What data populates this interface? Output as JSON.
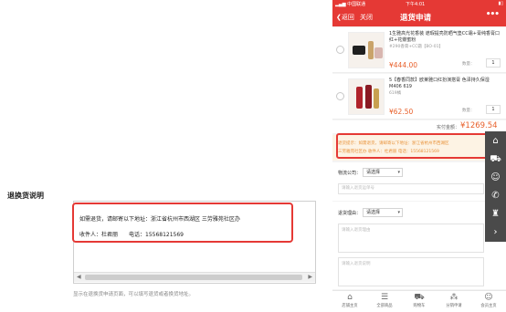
{
  "admin": {
    "section_title": "退换货说明",
    "textbox_line1": "如需退货，请邮寄以下地址：浙江省杭州市西湖区 三劳雅苑社区办",
    "textbox_line2": "收件人：杜君丽　　电话：15568121569",
    "hint": "显示在退换货申请页面，可以填写退货或者换货地址。"
  },
  "phone": {
    "status_bar": {
      "carrier": "中国联通",
      "time": "下午4:01"
    },
    "nav": {
      "back": "返回",
      "close": "关闭",
      "title": "退货申请",
      "more": "•••"
    },
    "products": [
      {
        "name": "1生雅高光花香装 遮瑕提亮防晒气垫CC霜+膏纯香膏口红+花瓣蜜粉",
        "spec": "#290香膏+CC霜【BO-01】",
        "price": "¥444.00",
        "qty_label": "数量：",
        "qty": "1"
      },
      {
        "name": "5【春香同款】欧莱雅口红扮演搭膏 色泽持久保湿 M406 619",
        "spec": "619橘",
        "price": "¥62.50",
        "qty_label": "数量：",
        "qty": "1"
      }
    ],
    "total": {
      "label": "实付金额：",
      "value": "¥1269.54"
    },
    "notice": {
      "line1": "退货提示：如需退货，请邮寄以下地址：浙江省杭州市西湖区",
      "line2": "三劳雅苑社区办 收件人：杜君丽 电话：15568121569"
    },
    "logistics": {
      "label": "物流公司：",
      "select": "请选择",
      "placeholder": "请输入退货运单号"
    },
    "reason": {
      "label": "退货理由：",
      "select": "请选择",
      "placeholder": "请输入退货理由"
    },
    "note": {
      "placeholder": "请输入退货说明"
    },
    "tabs": [
      {
        "label": "店铺主页",
        "icon": "home-icon"
      },
      {
        "label": "全部商品",
        "icon": "list-icon"
      },
      {
        "label": "购物车",
        "icon": "cart-icon"
      },
      {
        "label": "分销申请",
        "icon": "network-icon"
      },
      {
        "label": "会员主页",
        "icon": "user-icon"
      }
    ],
    "toolbar_icons": [
      "home-icon",
      "cart-icon",
      "user-icon",
      "phone-icon",
      "trophy-icon",
      "chevron-right-icon"
    ]
  },
  "colors": {
    "accent_red": "#e53935",
    "price_orange": "#e8612c",
    "notice_text": "#e8923a",
    "notice_bg": "#fdf3e4"
  }
}
